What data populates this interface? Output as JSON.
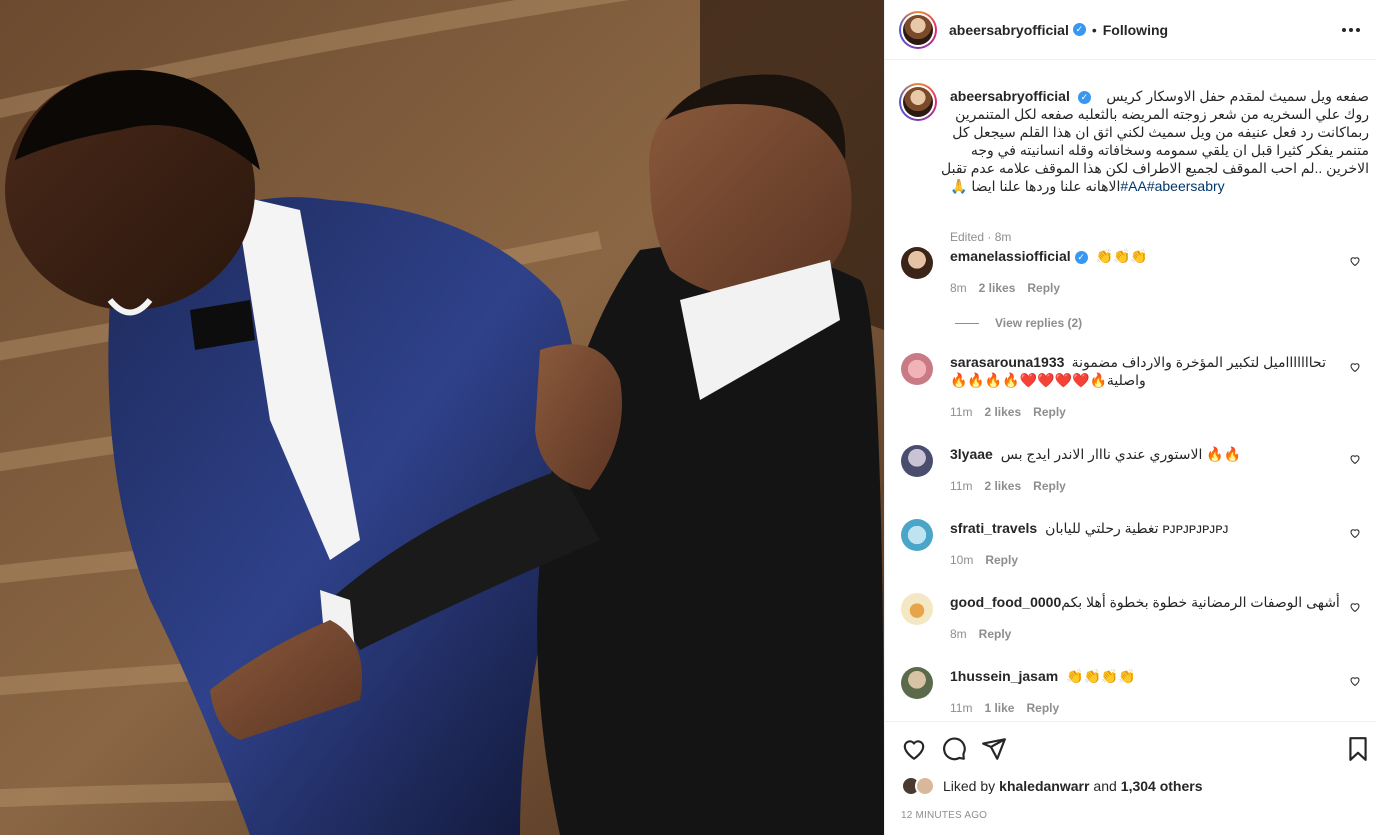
{
  "post": {
    "author": "abeersabryofficial",
    "follow_sep": "•",
    "follow_status": "Following",
    "caption": {
      "line1": "صفعه ويل سميث لمقدم حفل الاوسكار كريس",
      "line2": "روك علي السخريه من شعر زوجته المريضه بالثعلبه صفعه لكل المتنمرين",
      "line3": "ربماكانت رد فعل عنيفه من ويل سميث لكني اثق ان هذا القلم سيجعل كل",
      "line4": "متنمر يفكر كثيرا قبل ان يلقي سمومه وسخافاته وقله انسانيته في وجه",
      "line5": "الاخرين ..لم احب الموقف لجميع الاطراف لكن هذا الموقف علامه عدم تقبل",
      "line6": "الاهانه علنا وردها علنا ايضا 🙏",
      "hashtags": "#AA#abeersabry",
      "meta": "Edited · 8m"
    },
    "view_replies": "View replies (2)",
    "comments": [
      {
        "user": "emanelassiofficial",
        "verified": true,
        "text": "👏👏👏",
        "time": "8m",
        "likes": "2 likes",
        "reply": "Reply"
      },
      {
        "user": "sarasarouna1933",
        "verified": false,
        "text": "تحاااااااميل لتكبير المؤخرة والارداف مضمونة",
        "text2": "واصلية🔥❤️❤️❤️❤️🔥🔥🔥🔥",
        "time": "11m",
        "likes": "2 likes",
        "reply": "Reply"
      },
      {
        "user": "3lyaae",
        "verified": false,
        "text": "الاستوري عندي نااار الاندر ايدج بس 🔥🔥",
        "time": "11m",
        "likes": "2 likes",
        "reply": "Reply"
      },
      {
        "user": "sfrati_travels",
        "verified": false,
        "text": "تغطية رحلتي لليابان ᴘᴊᴘᴊᴘᴊᴘᴊᴘᴊ",
        "time": "10m",
        "likes": "",
        "reply": "Reply"
      },
      {
        "user": "good_food_0000",
        "verified": false,
        "text": "أشهى الوصفات الرمضانية خطوة بخطوة أهلا بكم",
        "time": "8m",
        "likes": "",
        "reply": "Reply"
      },
      {
        "user": "1hussein_jasam",
        "verified": false,
        "text": "👏👏👏👏",
        "time": "11m",
        "likes": "1 like",
        "reply": "Reply"
      }
    ]
  },
  "likes": {
    "prefix": "Liked by",
    "user": "khaledanwarr",
    "and": "and",
    "others": "1,304 others"
  },
  "time_ago": "12 MINUTES AGO",
  "icons": {
    "like": "heart-icon",
    "comment": "comment-icon",
    "share": "share-icon",
    "save": "bookmark-icon",
    "more": "more-options-icon"
  },
  "colors": {
    "verified": "#3897f0",
    "hashtag": "#00376b",
    "meta": "#8e8e8e"
  }
}
